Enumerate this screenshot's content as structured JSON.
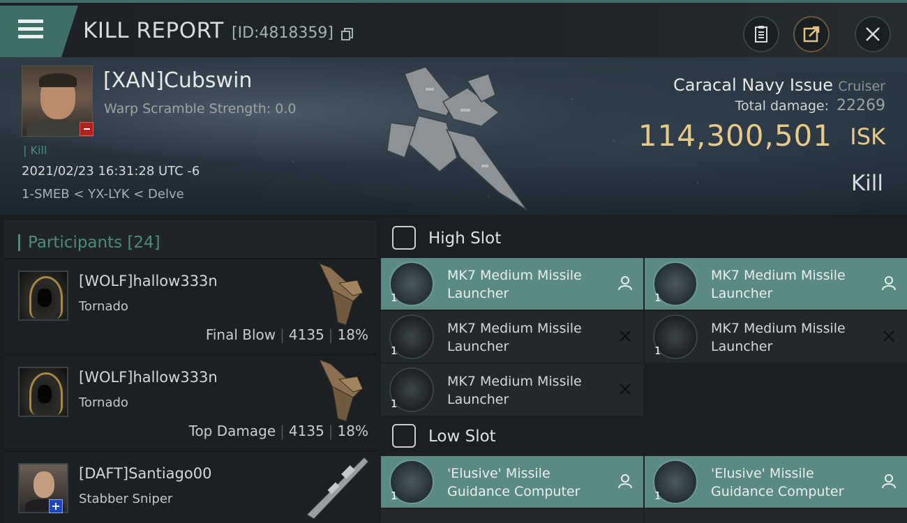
{
  "header": {
    "title": "KILL REPORT",
    "report_id": "[ID:4818359]"
  },
  "victim": {
    "name": "[XAN]Cubswin",
    "warp_scramble": "Warp Scramble Strength: 0.0",
    "kill_tag": "| Kill",
    "datetime": "2021/02/23 16:31:28 UTC -6",
    "location": "1-SMEB < YX-LYK < Delve",
    "ship_name": "Caracal Navy Issue",
    "ship_class": "Cruiser",
    "total_damage_label": "Total damage:",
    "total_damage": "22269",
    "isk_value": "114,300,501",
    "isk_unit": "ISK",
    "result": "Kill"
  },
  "participants": {
    "title": "Participants [24]",
    "rows": [
      {
        "name": "[WOLF]hallow333n",
        "ship": "Tornado",
        "role": "Final Blow",
        "damage": "4135",
        "percent": "18%"
      },
      {
        "name": "[WOLF]hallow333n",
        "ship": "Tornado",
        "role": "Top Damage",
        "damage": "4135",
        "percent": "18%"
      },
      {
        "name": "[DAFT]Santiago00",
        "ship": "Stabber Sniper",
        "role": "",
        "damage": "",
        "percent": ""
      }
    ]
  },
  "slots": {
    "high": {
      "label": "High Slot",
      "modules": [
        {
          "name": "MK7 Medium Missile Launcher",
          "qty": "1",
          "status": "dropped"
        },
        {
          "name": "MK7 Medium Missile Launcher",
          "qty": "1",
          "status": "dropped"
        },
        {
          "name": "MK7 Medium Missile Launcher",
          "qty": "1",
          "status": "destroyed"
        },
        {
          "name": "MK7 Medium Missile Launcher",
          "qty": "1",
          "status": "destroyed"
        },
        {
          "name": "MK7 Medium Missile Launcher",
          "qty": "1",
          "status": "destroyed"
        }
      ]
    },
    "low": {
      "label": "Low Slot",
      "modules": [
        {
          "name": "'Elusive' Missile Guidance Computer",
          "qty": "1",
          "status": "dropped"
        },
        {
          "name": "'Elusive' Missile Guidance Computer",
          "qty": "1",
          "status": "dropped"
        }
      ]
    }
  },
  "colors": {
    "accent": "#3f6d67",
    "active_module": "#5a8a81",
    "isk_gold": "#e8c987",
    "kill_green": "#4f8a7d"
  },
  "icons": [
    "menu-icon",
    "copy-icon",
    "clipboard-icon",
    "share-icon",
    "close-icon",
    "shield-icon",
    "pilot-icon",
    "destroyed-x-icon"
  ]
}
